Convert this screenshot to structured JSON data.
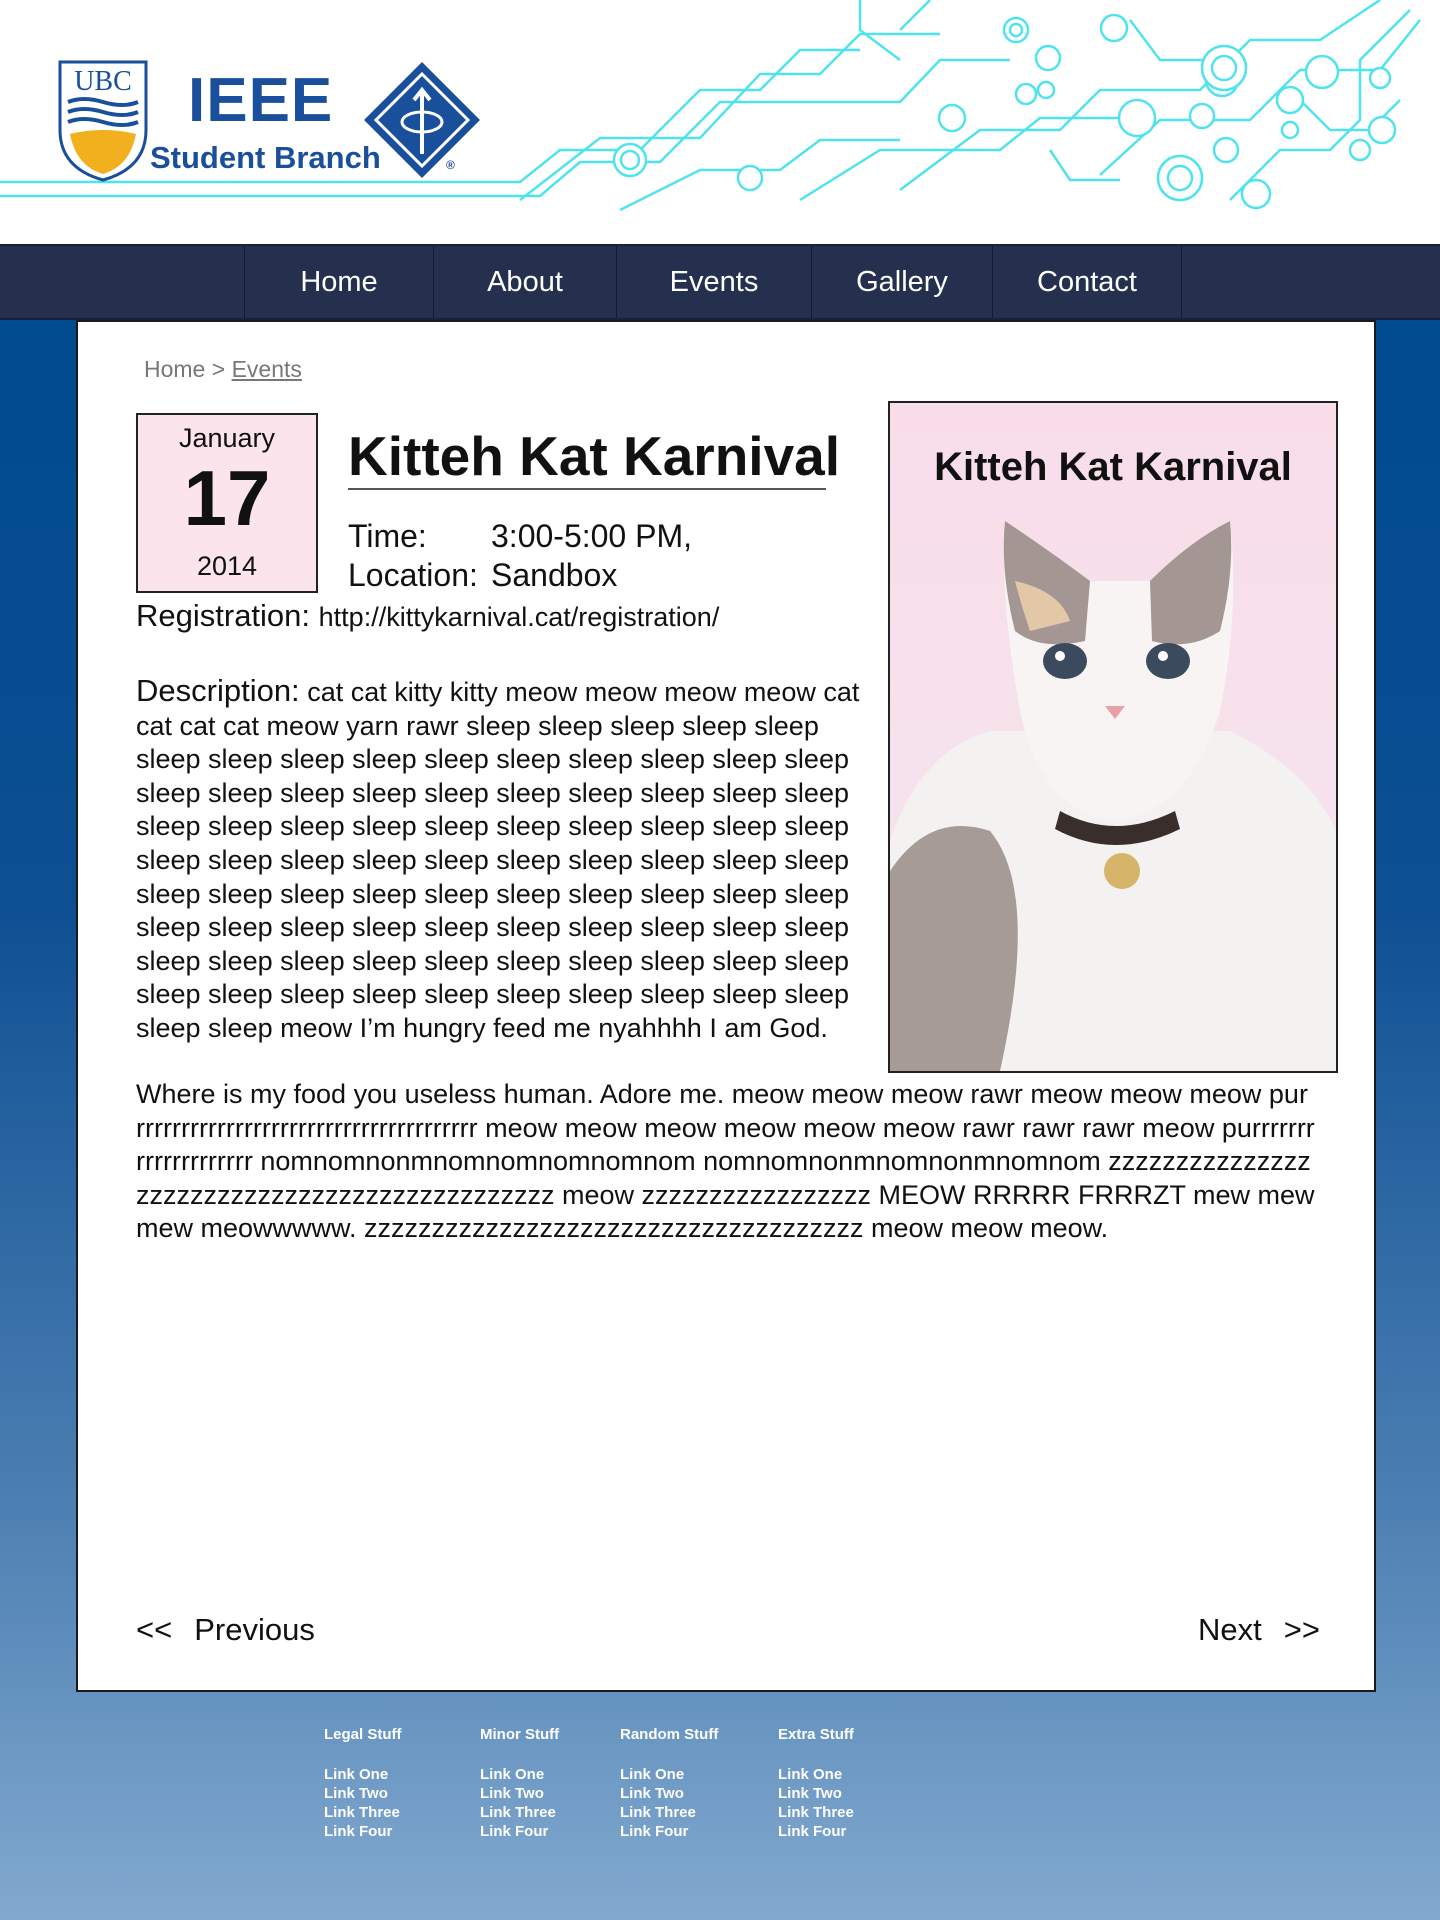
{
  "header": {
    "ubc_logo_text": "UBC",
    "ieee_text": "IEEE",
    "branch_text": "Student Branch",
    "reg_mark": "®"
  },
  "nav": {
    "items": [
      "Home",
      "About",
      "Events",
      "Gallery",
      "Contact"
    ]
  },
  "breadcrumb": {
    "home": "Home",
    "separator": ">",
    "current": "Events"
  },
  "event": {
    "date": {
      "month": "January",
      "day": "17",
      "year": "2014"
    },
    "title": "Kitteh Kat Karnival",
    "time_label": "Time:",
    "time_value": "3:00-5:00 PM,",
    "location_label": "Location:",
    "location_value": "Sandbox",
    "registration_label": "Registration:",
    "registration_value": "http://kittykarnival.cat/registration/",
    "description_label": "Description:",
    "description_text": "cat cat kitty kitty meow meow meow meow cat cat cat cat meow yarn rawr sleep sleep sleep sleep sleep sleep sleep sleep sleep sleep sleep sleep sleep sleep sleep sleep sleep sleep sleep sleep sleep sleep sleep sleep sleep sleep sleep sleep sleep sleep sleep sleep sleep sleep sleep sleep sleep sleep sleep sleep sleep sleep sleep sleep sleep sleep sleep sleep sleep sleep sleep sleep sleep sleep sleep sleep sleep sleep sleep sleep sleep sleep sleep sleep sleep sleep sleep sleep sleep sleep sleep sleep sleep sleep sleep sleep sleep sleep sleep sleep sleep sleep sleep sleep sleep sleep sleep meow I’m hungry feed me nyahhhh I am God.",
    "paragraph_2": "Where is my food you useless human. Adore me. meow meow meow rawr meow meow meow purrrrrrrrrrrrrrrrrrrrrrrrrrrrrrrrrrrrrrr meow meow meow meow meow meow rawr rawr rawr meow purrrrrrrrrrrrrrrrrrrr nomnomnonmnomnomnomnomnom nomnomnonmnomnonmnomnom zzzzzzzzzzzzzzzzzzzzzzzzzzzzzzzzzzzzzzzzzzzzzz meow zzzzzzzzzzzzzzzzz MEOW RRRRR FRRRZT mew mew mew meowwwww. zzzzzzzzzzzzzzzzzzzzzzzzzzzzzzzzzzzzz meow meow meow.",
    "poster_title": "Kitteh Kat Karnival"
  },
  "pager": {
    "prev_arrow": "<<",
    "prev_label": "Previous",
    "next_label": "Next",
    "next_arrow": ">>"
  },
  "footer": {
    "columns": [
      {
        "heading": "Legal Stuff",
        "links": [
          "Link One",
          "Link Two",
          "Link Three",
          "Link Four"
        ]
      },
      {
        "heading": "Minor Stuff",
        "links": [
          "Link One",
          "Link Two",
          "Link Three",
          "Link Four"
        ]
      },
      {
        "heading": "Random Stuff",
        "links": [
          "Link One",
          "Link Two",
          "Link Three",
          "Link Four"
        ]
      },
      {
        "heading": "Extra Stuff",
        "links": [
          "Link One",
          "Link Two",
          "Link Three",
          "Link Four"
        ]
      }
    ]
  },
  "colors": {
    "brand_blue": "#1a4f9c",
    "nav_bg": "#25304f",
    "circuit_cyan": "#4fe3ee",
    "date_box_bg": "#fbe4ec",
    "page_bg_top": "#004a8f"
  },
  "icons": [
    "ubc-shield-icon",
    "ieee-diamond-icon",
    "circuit-decoration",
    "cat-photo"
  ]
}
